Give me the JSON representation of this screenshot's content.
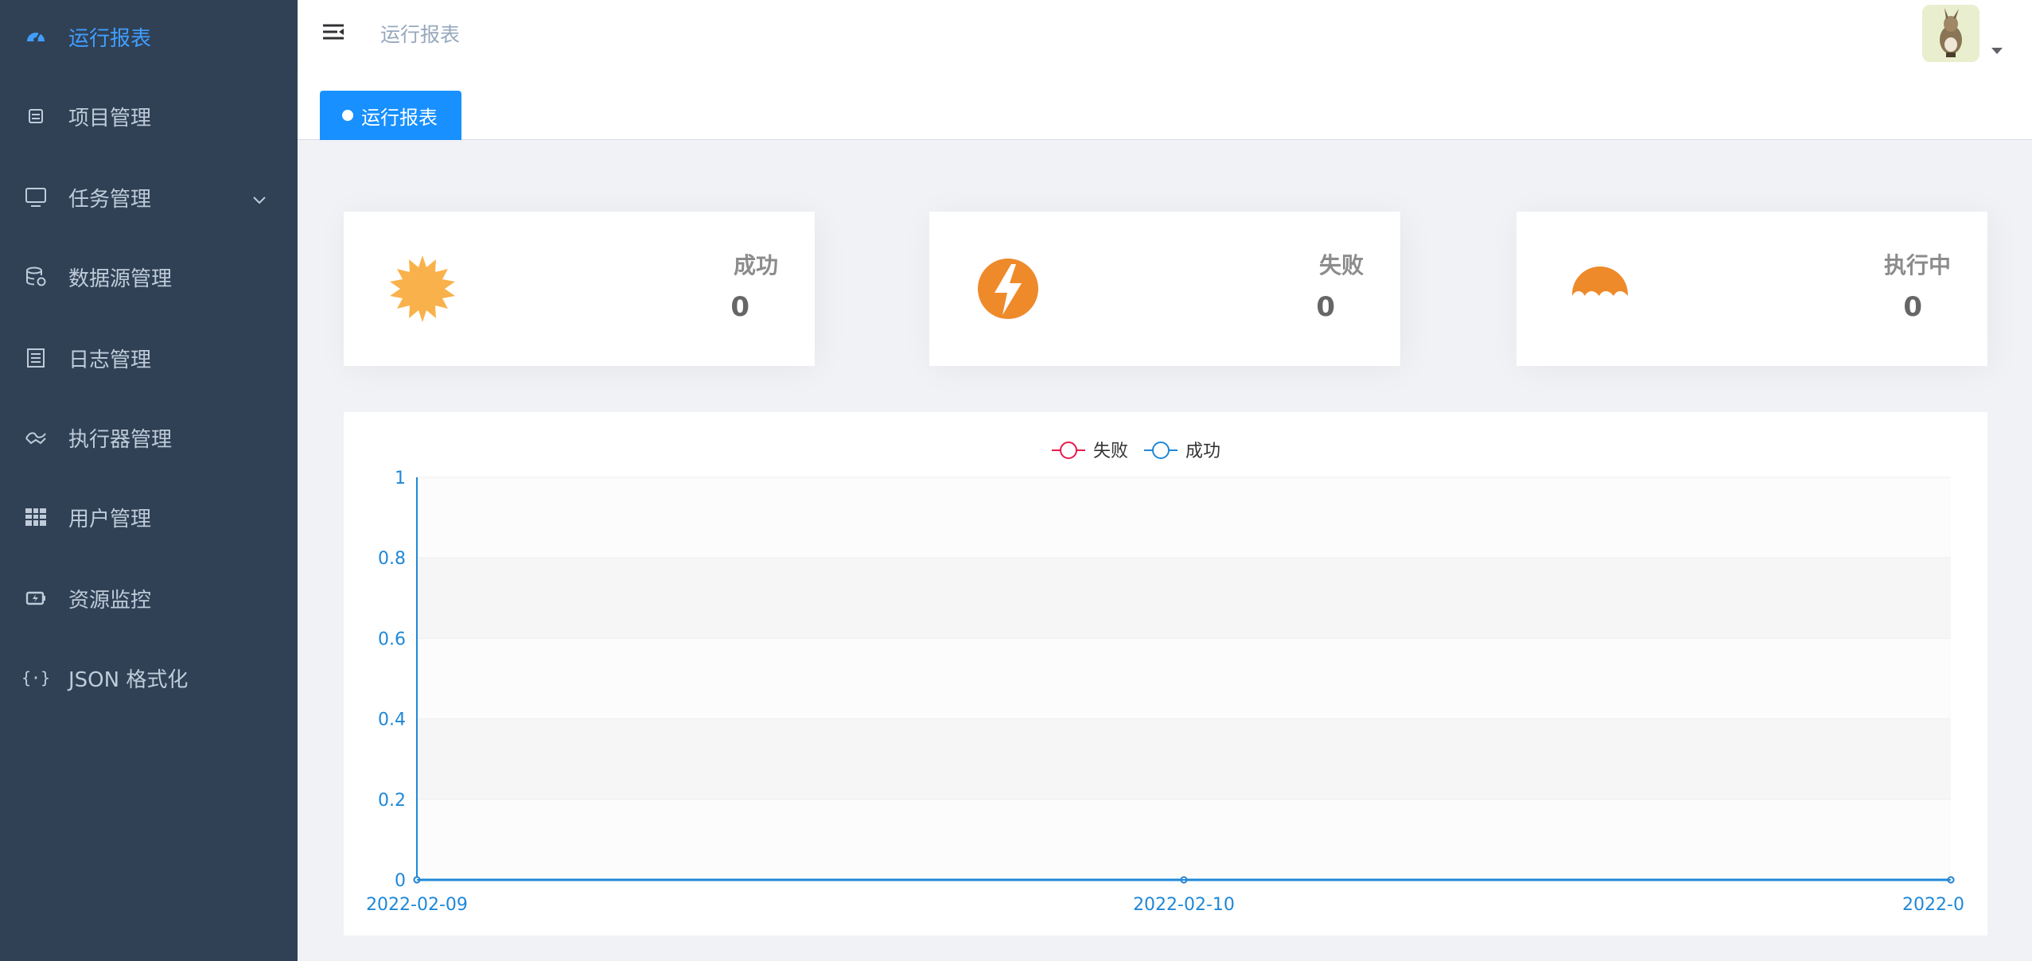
{
  "sidebar": {
    "items": [
      {
        "label": "运行报表",
        "icon": "dashboard-icon",
        "active": true
      },
      {
        "label": "项目管理",
        "icon": "project-icon"
      },
      {
        "label": "任务管理",
        "icon": "monitor-icon",
        "has_submenu": true
      },
      {
        "label": "数据源管理",
        "icon": "database-icon"
      },
      {
        "label": "日志管理",
        "icon": "log-icon"
      },
      {
        "label": "执行器管理",
        "icon": "executor-icon"
      },
      {
        "label": "用户管理",
        "icon": "table-icon"
      },
      {
        "label": "资源监控",
        "icon": "battery-icon"
      },
      {
        "label": "JSON 格式化",
        "icon": "json-braces-icon"
      }
    ]
  },
  "header": {
    "breadcrumb": "运行报表"
  },
  "tags_view": {
    "active_tag": "运行报表"
  },
  "cards": [
    {
      "label": "成功",
      "value": "0",
      "icon": "sun-icon",
      "color": "#f9b24b"
    },
    {
      "label": "失败",
      "value": "0",
      "icon": "lightning-icon",
      "color": "#ee8a2a"
    },
    {
      "label": "执行中",
      "value": "0",
      "icon": "crescent-icon",
      "color": "#ee8a2a"
    }
  ],
  "chart_data": {
    "type": "line",
    "x": [
      "2022-02-09",
      "2022-02-10",
      "2022-0"
    ],
    "series": [
      {
        "name": "失败",
        "values": [
          0,
          0,
          0
        ],
        "color": "#e6194b"
      },
      {
        "name": "成功",
        "values": [
          0,
          0,
          0
        ],
        "color": "#1f88d8"
      }
    ],
    "ylim": [
      0,
      1
    ],
    "yticks": [
      "0",
      "0.2",
      "0.4",
      "0.6",
      "0.8",
      "1"
    ],
    "legend": "top-center",
    "grid": true
  }
}
